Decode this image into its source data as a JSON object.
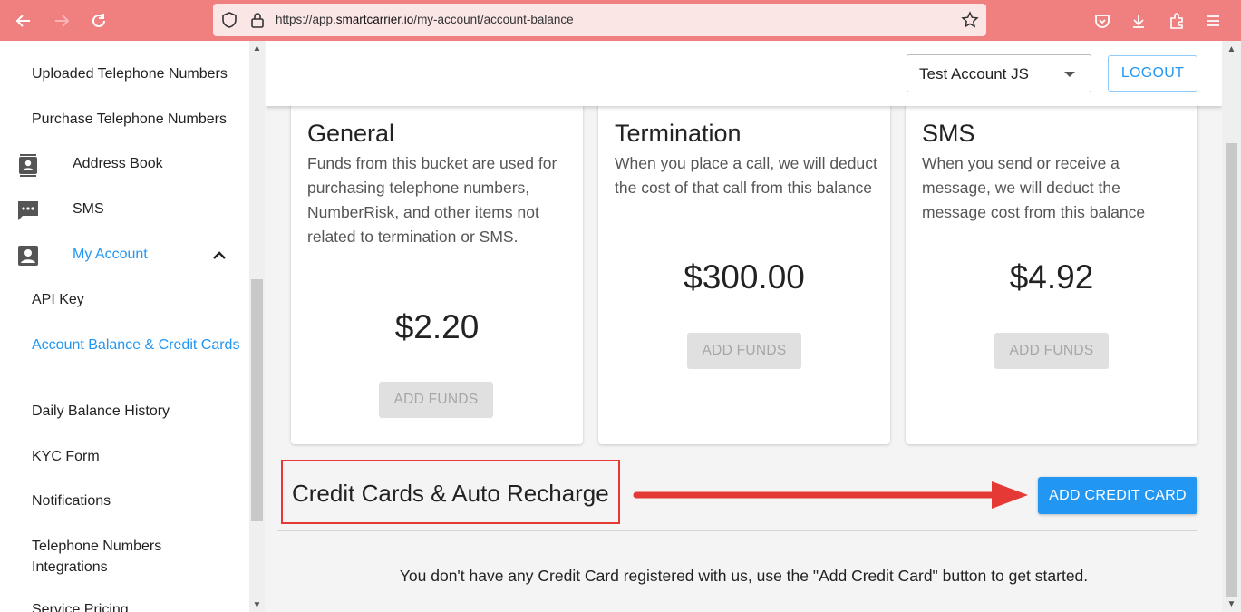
{
  "browser": {
    "url_prefix": "https://app.",
    "url_domain": "smartcarrier.io",
    "url_path": "/my-account/account-balance"
  },
  "sidebar": {
    "items": [
      {
        "label": "Uploaded Telephone Numbers"
      },
      {
        "label": "Purchase Telephone Numbers"
      },
      {
        "label": "Address Book",
        "icon": "contact-card-icon"
      },
      {
        "label": "SMS",
        "icon": "chat-bubble-icon"
      },
      {
        "label": "My Account",
        "icon": "account-box-icon"
      },
      {
        "label": "API Key"
      },
      {
        "label": "Account Balance & Credit Cards"
      },
      {
        "label": "Daily Balance History"
      },
      {
        "label": "KYC Form"
      },
      {
        "label": "Notifications"
      },
      {
        "label": "Telephone Numbers Integrations"
      },
      {
        "label": "Service Pricing"
      }
    ]
  },
  "header": {
    "account": "Test Account JS",
    "logout_label": "LOGOUT"
  },
  "balances": [
    {
      "title": "General",
      "description": "Funds from this bucket are used for purchasing telephone numbers, NumberRisk, and other items not related to termination or SMS.",
      "amount": "$2.20",
      "button": "ADD FUNDS"
    },
    {
      "title": "Termination",
      "description": "When you place a call, we will deduct the cost of that call from this balance",
      "amount": "$300.00",
      "button": "ADD FUNDS"
    },
    {
      "title": "SMS",
      "description": "When you send or receive a message, we will deduct the message cost from this balance",
      "amount": "$4.92",
      "button": "ADD FUNDS"
    }
  ],
  "credit_cards": {
    "title": "Credit Cards & Auto Recharge",
    "add_label": "ADD CREDIT CARD",
    "empty_message": "You don't have any Credit Card registered with us, use the \"Add Credit Card\" button to get started."
  },
  "colors": {
    "accent": "#2196f3",
    "chrome": "#f08080",
    "highlight": "#e53935"
  }
}
